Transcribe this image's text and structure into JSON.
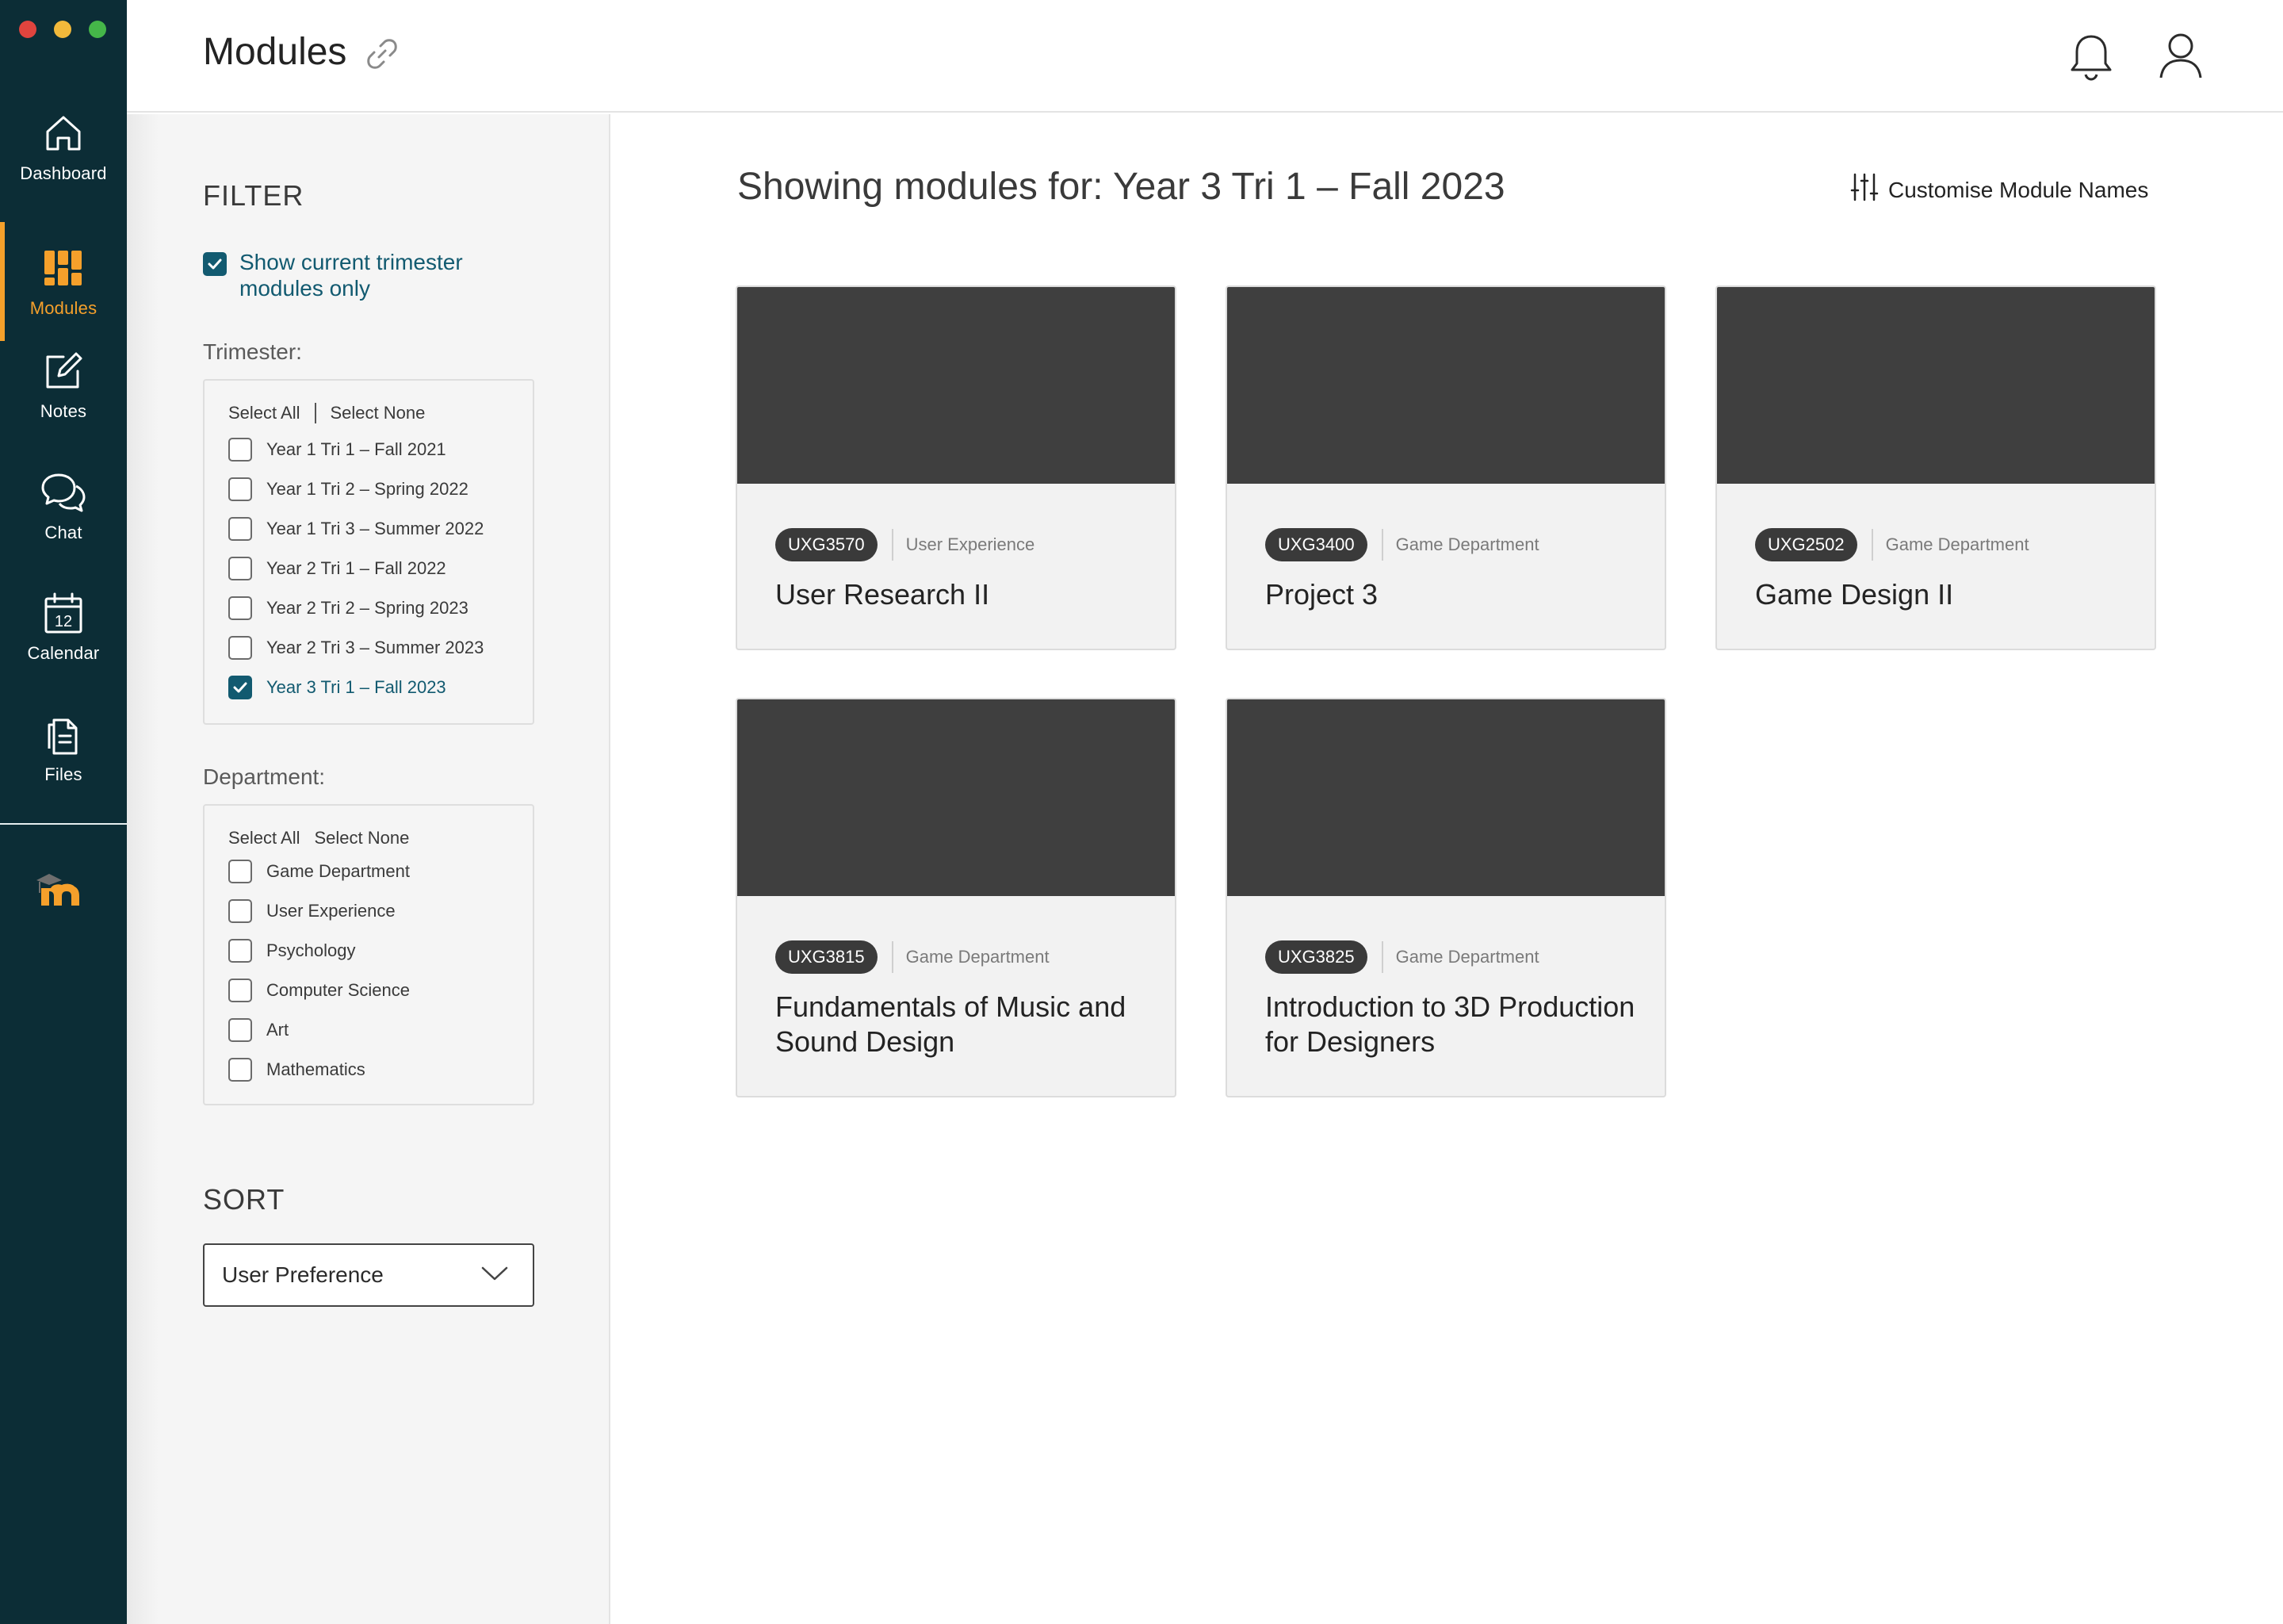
{
  "window": {
    "traffic_lights": [
      "#e0443e",
      "#f2b93b",
      "#45b649"
    ]
  },
  "nav": {
    "items": [
      {
        "label": "Dashboard",
        "icon": "home-icon",
        "active": false
      },
      {
        "label": "Modules",
        "icon": "modules-icon",
        "active": true
      },
      {
        "label": "Notes",
        "icon": "notes-icon",
        "active": false
      },
      {
        "label": "Chat",
        "icon": "chat-icon",
        "active": false
      },
      {
        "label": "Calendar",
        "icon": "calendar-icon",
        "active": false,
        "badge": "12"
      },
      {
        "label": "Files",
        "icon": "files-icon",
        "active": false
      }
    ],
    "logo_letter": "m",
    "accent": "#f5a02b",
    "background": "#0c2d36"
  },
  "header": {
    "title": "Modules"
  },
  "filter": {
    "title": "FILTER",
    "current_only": {
      "label": "Show current trimester modules only",
      "checked": true
    },
    "trimester": {
      "label": "Trimester:",
      "select_all": "Select All",
      "select_none": "Select None",
      "options": [
        {
          "label": "Year 1 Tri 1 – Fall 2021",
          "checked": false
        },
        {
          "label": "Year 1 Tri 2 – Spring 2022",
          "checked": false
        },
        {
          "label": "Year 1 Tri 3 – Summer 2022",
          "checked": false
        },
        {
          "label": "Year 2 Tri 1 – Fall 2022",
          "checked": false
        },
        {
          "label": "Year 2 Tri 2 – Spring 2023",
          "checked": false
        },
        {
          "label": "Year 2 Tri 3 – Summer 2023",
          "checked": false
        },
        {
          "label": "Year 3 Tri 1 – Fall 2023",
          "checked": true
        }
      ]
    },
    "department": {
      "label": "Department:",
      "select_all": "Select All",
      "select_none": "Select None",
      "options": [
        {
          "label": "Game Department",
          "checked": false
        },
        {
          "label": "User Experience",
          "checked": false
        },
        {
          "label": "Psychology",
          "checked": false
        },
        {
          "label": "Computer Science",
          "checked": false
        },
        {
          "label": "Art",
          "checked": false
        },
        {
          "label": "Mathematics",
          "checked": false
        }
      ]
    }
  },
  "sort": {
    "title": "SORT",
    "selected": "User Preference"
  },
  "main": {
    "heading": "Showing modules for: Year 3 Tri 1 – Fall 2023",
    "customise_label": "Customise Module Names",
    "modules": [
      {
        "code": "UXG3570",
        "department": "User Experience",
        "name": "User Research II"
      },
      {
        "code": "UXG3400",
        "department": "Game Department",
        "name": "Project 3"
      },
      {
        "code": "UXG2502",
        "department": "Game Department",
        "name": "Game Design II"
      },
      {
        "code": "UXG3815",
        "department": "Game Department",
        "name": "Fundamentals of Music and Sound Design"
      },
      {
        "code": "UXG3825",
        "department": "Game Department",
        "name": "Introduction to 3D Production for Designers"
      }
    ]
  },
  "colors": {
    "primary": "#125a70",
    "thumb": "#3f3f3f",
    "card": "#f2f2f2"
  }
}
